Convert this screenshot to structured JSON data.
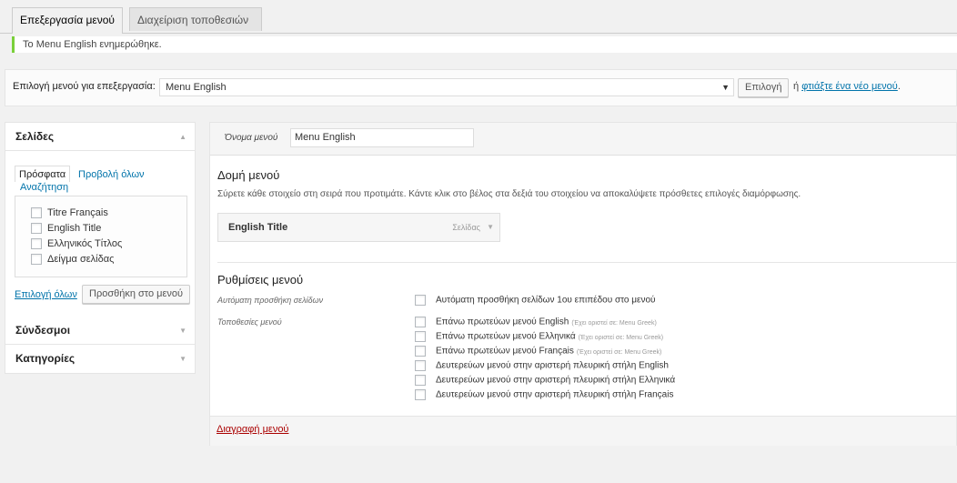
{
  "tabs": [
    {
      "label": "Επεξεργασία μενού",
      "active": true
    },
    {
      "label": "Διαχείριση τοποθεσιών",
      "active": false
    }
  ],
  "notice": {
    "prefix": "Το ",
    "menu_name": "Menu English",
    "suffix": " ενημερώθηκε."
  },
  "menu_select": {
    "label": "Επιλογή μενού για επεξεργασία:",
    "selected": "Menu English",
    "select_button": "Επιλογή",
    "or_text": "ή",
    "create_link": "φτιάξτε ένα νέο μενού",
    "period": "."
  },
  "sidebar": {
    "pages": {
      "title": "Σελίδες",
      "tabs": {
        "recent": "Πρόσφατα",
        "all": "Προβολή όλων",
        "search": "Αναζήτηση"
      },
      "items": [
        "Titre Français",
        "English Title",
        "Ελληνικός Τίτλος",
        "Δείγμα σελίδας"
      ],
      "select_all": "Επιλογή όλων",
      "add_button": "Προσθήκη στο μενού"
    },
    "links_title": "Σύνδεσμοι",
    "categories_title": "Κατηγορίες"
  },
  "main": {
    "name_label": "Όνομα μενού",
    "name_value": "Menu English",
    "structure_title": "Δομή μενού",
    "structure_desc": "Σύρετε κάθε στοιχείο στη σειρά που προτιμάτε. Κάντε κλικ στο βέλος στα δεξιά του στοιχείου να αποκαλύψετε πρόσθετες επιλογές διαμόρφωσης.",
    "menu_item": {
      "title": "English Title",
      "type": "Σελίδας"
    },
    "settings_title": "Ρυθμίσεις μενού",
    "auto_add_label": "Αυτόματη προσθήκη σελίδων",
    "auto_add_option": "Αυτόματη προσθήκη σελίδων 1ου επιπέδου στο μενού",
    "locations_label": "Τοποθεσίες μενού",
    "locations": [
      {
        "label": "Επάνω πρωτεύων μενού English",
        "note": "(Έχει οριστεί σε: Menu Greek)"
      },
      {
        "label": "Επάνω πρωτεύων μενού Ελληνικά",
        "note": "(Έχει οριστεί σε: Menu Greek)"
      },
      {
        "label": "Επάνω πρωτεύων μενού Français",
        "note": "(Έχει οριστεί σε: Menu Greek)"
      },
      {
        "label": "Δευτερεύων μενού στην αριστερή πλευρική στήλη English",
        "note": ""
      },
      {
        "label": "Δευτερεύων μενού στην αριστερή πλευρική στήλη Ελληνικά",
        "note": ""
      },
      {
        "label": "Δευτερεύων μενού στην αριστερή πλευρική στήλη Français",
        "note": ""
      }
    ],
    "delete_link": "Διαγραφή μενού"
  },
  "colors": {
    "notice_border": "#7ad03a",
    "link": "#0073aa",
    "delete": "#aa0000"
  },
  "icons": {
    "dropdown": "triangle-down",
    "collapse": "triangle-up",
    "expand": "triangle-down"
  }
}
